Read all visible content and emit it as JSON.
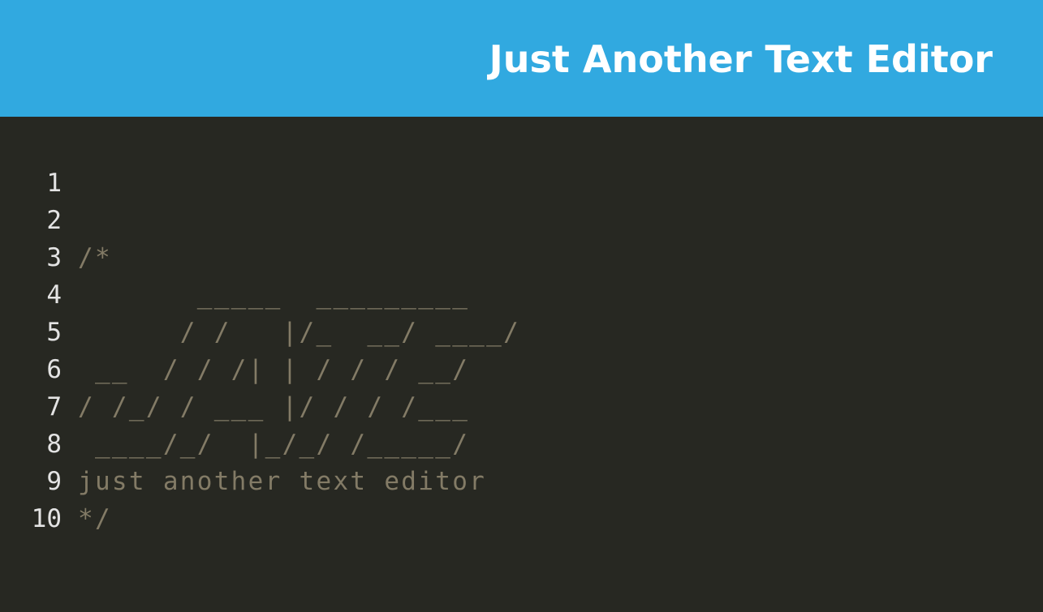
{
  "header": {
    "title": "Just Another Text Editor"
  },
  "editor": {
    "lines": [
      {
        "number": "1",
        "text": ""
      },
      {
        "number": "2",
        "text": "/*"
      },
      {
        "number": "3",
        "text": "       _____  _________"
      },
      {
        "number": "4",
        "text": "      / /   |/_  __/ ____/"
      },
      {
        "number": "5",
        "text": " __  / / /| | / / / __/"
      },
      {
        "number": "6",
        "text": "/ /_/ / ___ |/ / / /___"
      },
      {
        "number": "7",
        "text": " ____/_/  |_/_/ /_____/"
      },
      {
        "number": "8",
        "text": "just another text editor"
      },
      {
        "number": "9",
        "text": "*/"
      },
      {
        "number": "10",
        "text": ""
      }
    ]
  },
  "colors": {
    "header_background": "#31a9e0",
    "editor_background": "#272822",
    "line_number": "#e3e3e3",
    "comment_text": "#837b66"
  }
}
